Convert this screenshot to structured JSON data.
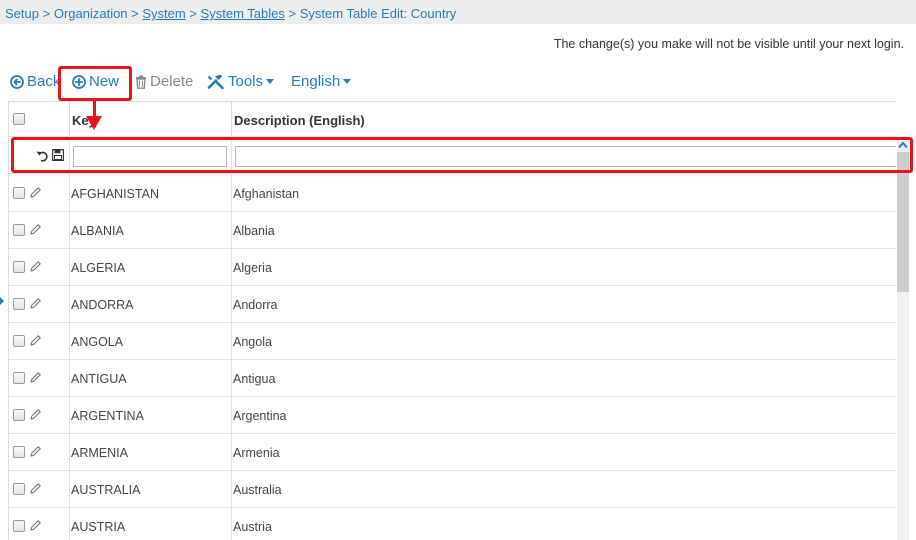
{
  "breadcrumb": {
    "items": [
      {
        "label": "Setup",
        "link": false
      },
      {
        "label": "Organization",
        "link": false
      },
      {
        "label": "System",
        "link": true
      },
      {
        "label": "System Tables",
        "link": true
      },
      {
        "label": "System Table Edit: Country",
        "link": false
      }
    ],
    "separator": ">"
  },
  "notice": "The change(s) you make will not be visible until your next login.",
  "toolbar": {
    "back_label": "Back",
    "new_label": "New",
    "delete_label": "Delete",
    "tools_label": "Tools",
    "language_label": "English"
  },
  "grid": {
    "columns": {
      "key": "Key",
      "description": "Description (English)"
    },
    "filter": {
      "key_value": "",
      "description_value": ""
    },
    "rows": [
      {
        "key": "AFGHANISTAN",
        "description": "Afghanistan"
      },
      {
        "key": "ALBANIA",
        "description": "Albania"
      },
      {
        "key": "ALGERIA",
        "description": "Algeria"
      },
      {
        "key": "ANDORRA",
        "description": "Andorra"
      },
      {
        "key": "ANGOLA",
        "description": "Angola"
      },
      {
        "key": "ANTIGUA",
        "description": "Antigua"
      },
      {
        "key": "ARGENTINA",
        "description": "Argentina"
      },
      {
        "key": "ARMENIA",
        "description": "Armenia"
      },
      {
        "key": "AUSTRALIA",
        "description": "Australia"
      },
      {
        "key": "AUSTRIA",
        "description": "Austria"
      }
    ]
  },
  "colors": {
    "link": "#2a7ab0",
    "highlight": "#e8141b",
    "breadcrumb_bg": "#eeeeee"
  }
}
